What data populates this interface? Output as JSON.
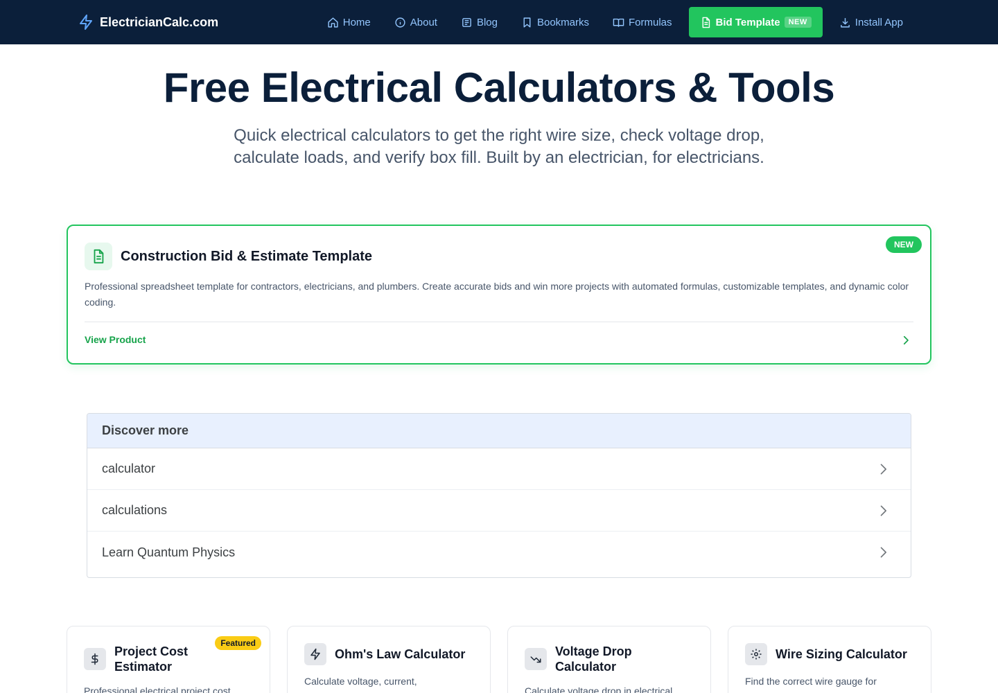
{
  "nav": {
    "brand": "ElectricianCalc.com",
    "links": [
      {
        "label": "Home",
        "icon": "home-icon"
      },
      {
        "label": "About",
        "icon": "info-icon"
      },
      {
        "label": "Blog",
        "icon": "newspaper-icon"
      },
      {
        "label": "Bookmarks",
        "icon": "bookmark-icon"
      },
      {
        "label": "Formulas",
        "icon": "book-icon"
      }
    ],
    "cta": {
      "label": "Bid Template",
      "badge": "NEW"
    },
    "install": {
      "label": "Install App"
    }
  },
  "hero": {
    "title": "Free Electrical Calculators & Tools",
    "subtitle": "Quick electrical calculators to get the right wire size, check voltage drop, calculate loads, and verify box fill. Built by an electrician, for electricians."
  },
  "promo": {
    "title": "Construction Bid & Estimate Template",
    "badge": "NEW",
    "description": "Professional spreadsheet template for contractors, electricians, and plumbers. Create accurate bids and win more projects with automated formulas, customizable templates, and dynamic color coding.",
    "link": "View Product"
  },
  "discover": {
    "heading": "Discover more",
    "items": [
      "calculator",
      "calculations",
      "Learn Quantum Physics"
    ]
  },
  "cards": [
    {
      "title": "Project Cost Estimator",
      "badge": "Featured",
      "description": "Professional electrical project cost",
      "icon": "dollar-icon"
    },
    {
      "title": "Ohm's Law Calculator",
      "description": "Calculate voltage, current,",
      "icon": "bolt-icon"
    },
    {
      "title": "Voltage Drop Calculator",
      "description": "Calculate voltage drop in electrical",
      "icon": "trending-down-icon"
    },
    {
      "title": "Wire Sizing Calculator",
      "description": "Find the correct wire gauge for",
      "icon": "gear-icon"
    }
  ],
  "colors": {
    "nav_bg": "#0b1f3a",
    "accent": "#22c55e",
    "link": "#93c5fd",
    "featured": "#facc15"
  }
}
